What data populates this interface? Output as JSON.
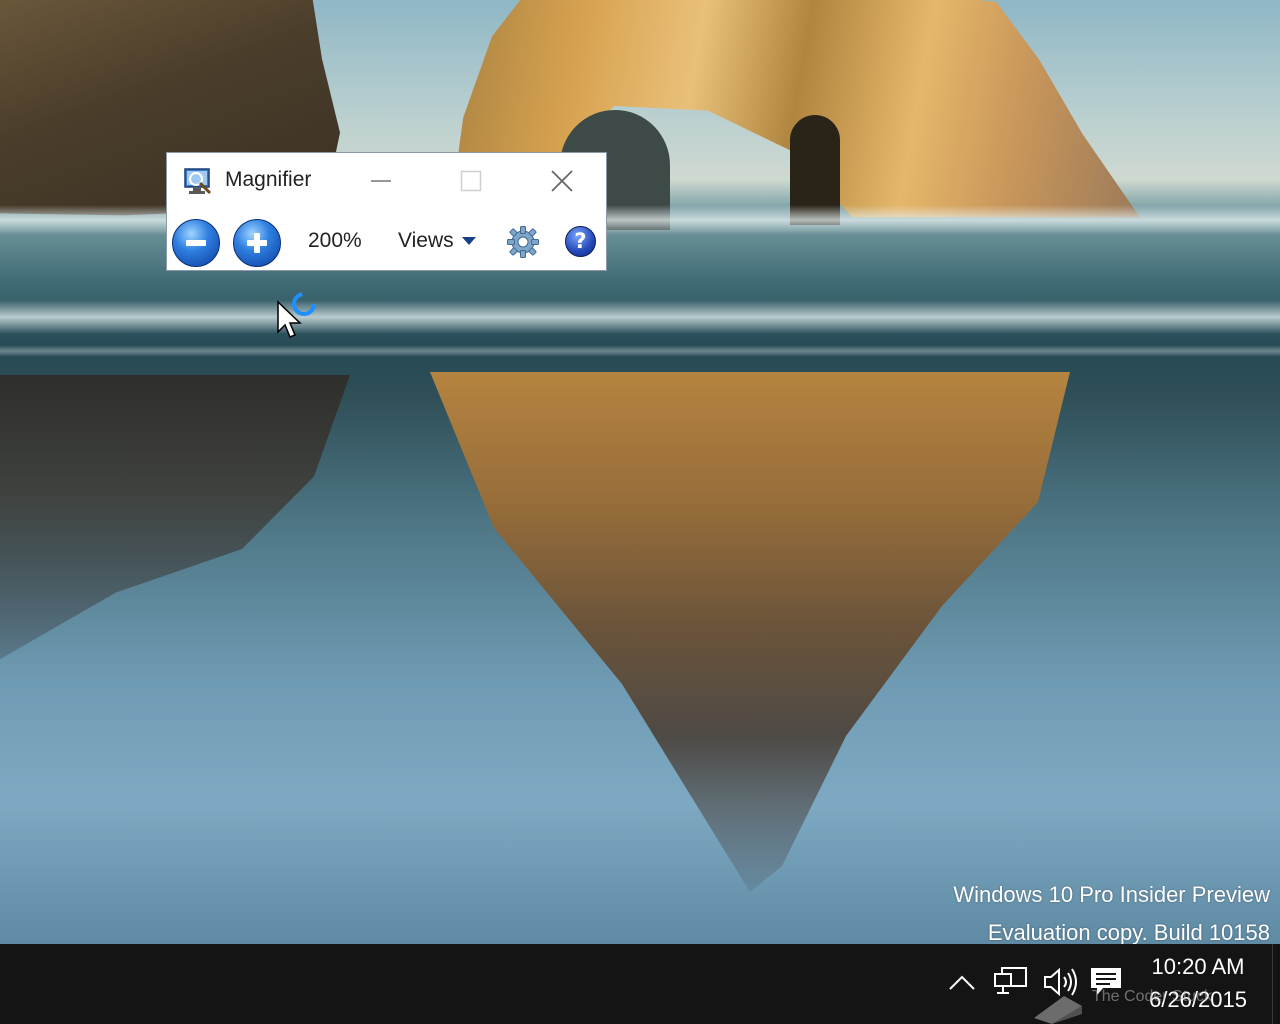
{
  "magnifier": {
    "title": "Magnifier",
    "zoom_level": "200%",
    "views_label": "Views",
    "help_glyph": "?",
    "icons": [
      "magnifier-app-icon",
      "minimize-icon",
      "maximize-icon",
      "close-icon",
      "zoom-out-icon",
      "zoom-in-icon",
      "chevron-down-icon",
      "gear-icon",
      "help-icon"
    ]
  },
  "watermark": {
    "line1": "Windows 10 Pro Insider Preview",
    "line2": "Evaluation copy. Build 10158"
  },
  "taskbar": {
    "time": "10:20 AM",
    "date": "6/26/2015",
    "tray_icons": [
      "chevron-up-icon",
      "network-icon",
      "volume-icon",
      "action-center-icon"
    ]
  },
  "overlay_text": "The Coder Stuck",
  "colors": {
    "taskbar": "#141414",
    "accent_blue": "#2f7fe0",
    "window_bg": "#ffffff"
  }
}
